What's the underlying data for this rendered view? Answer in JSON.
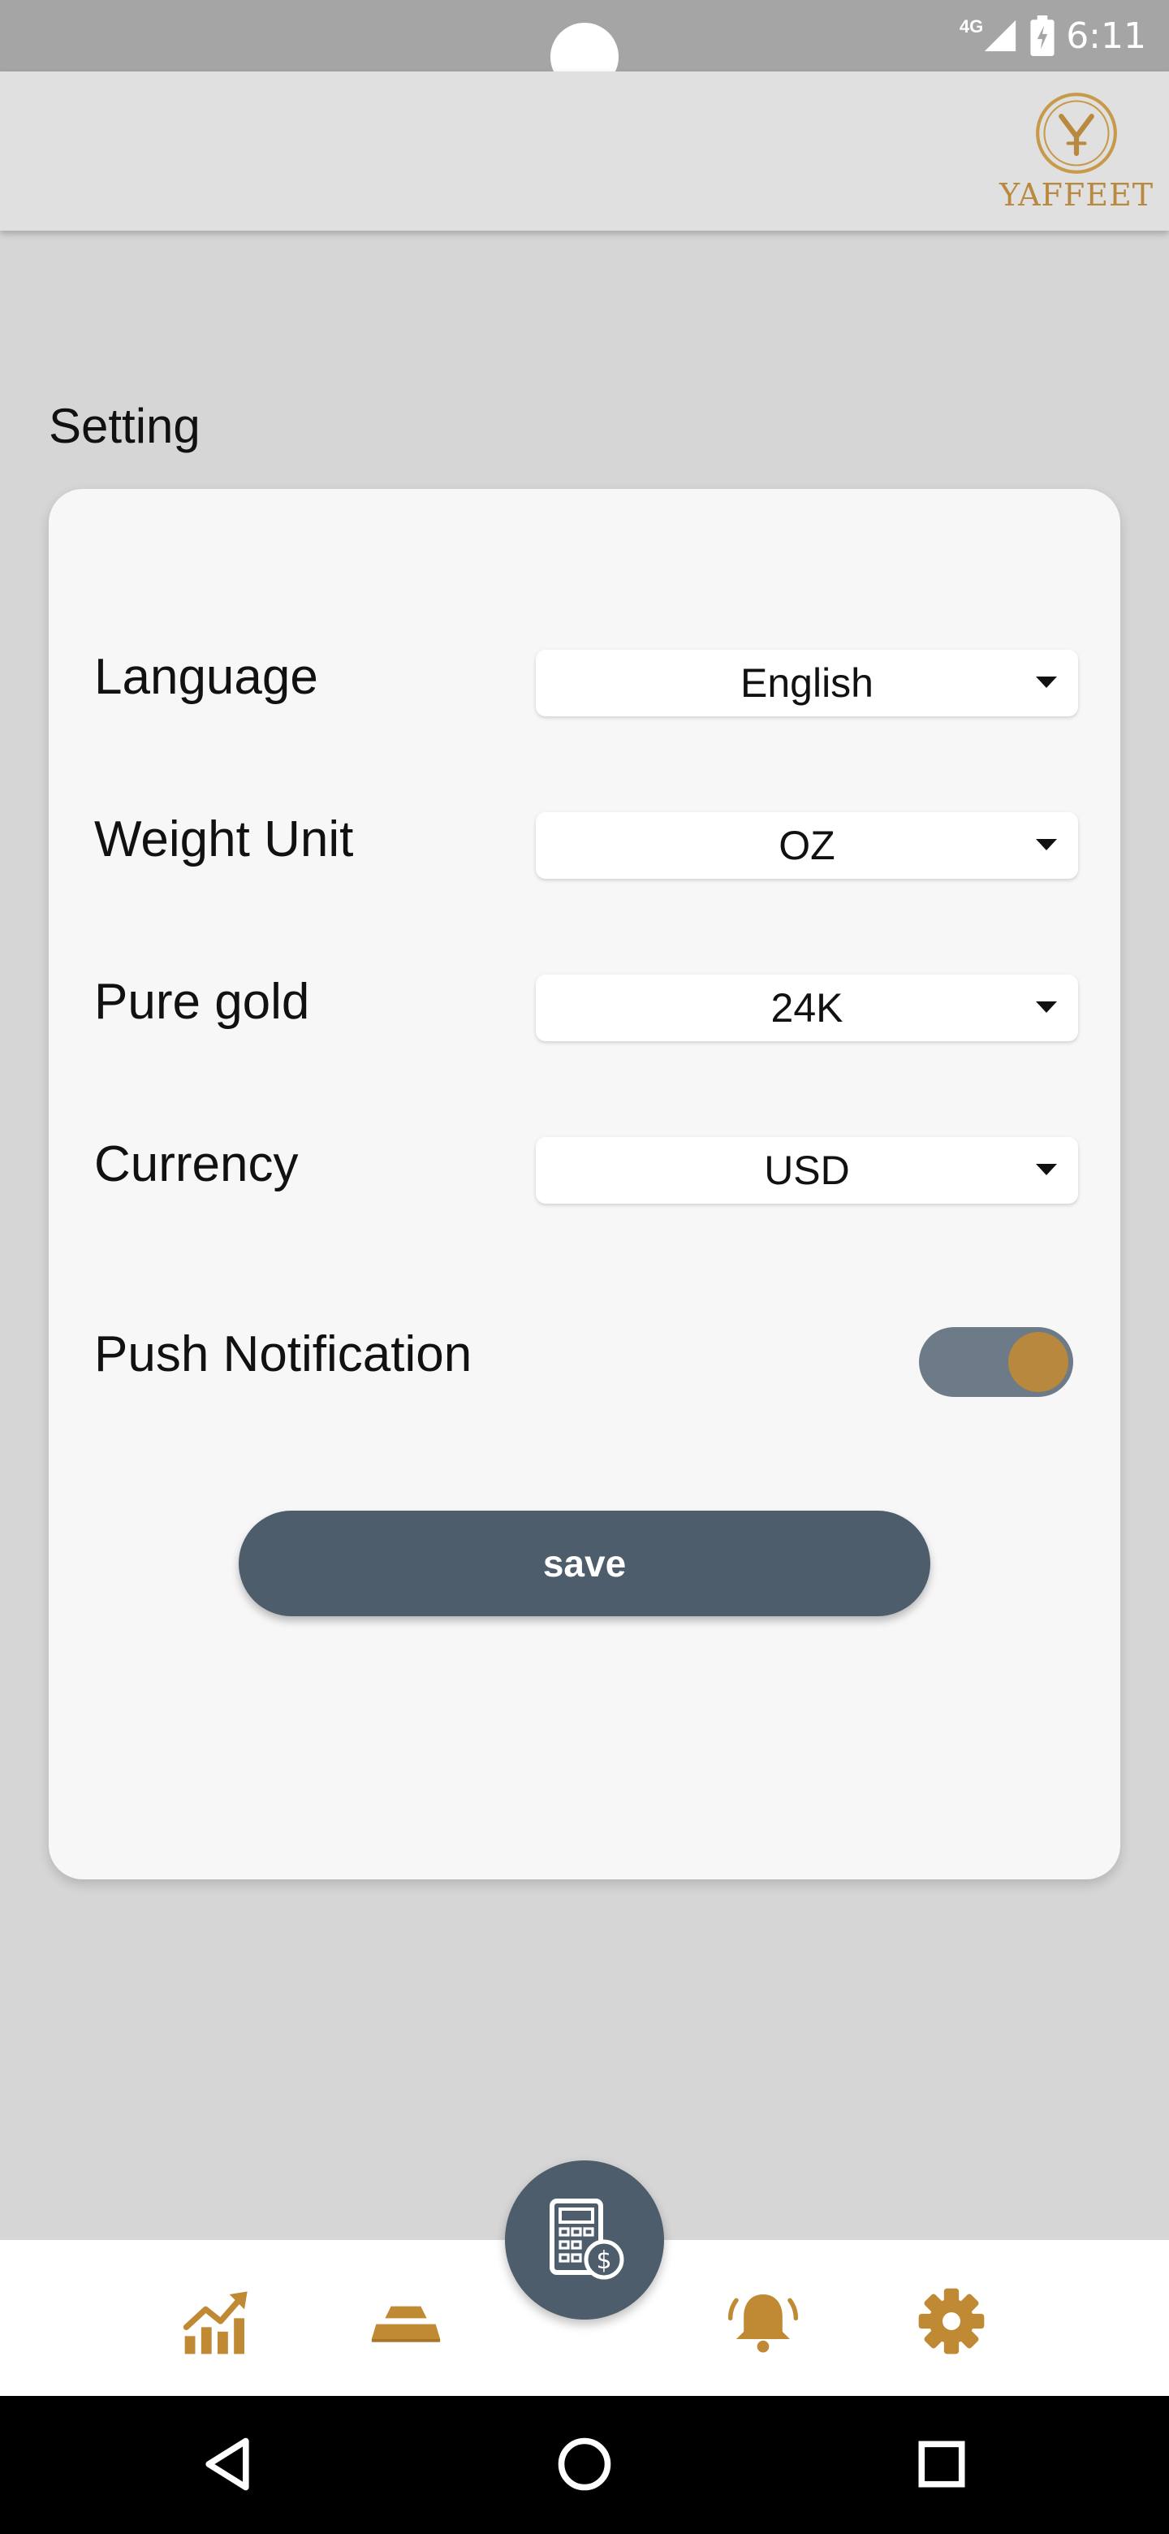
{
  "status_bar": {
    "network": "4G",
    "time": "6:11"
  },
  "header": {
    "brand_name": "YAFFEET",
    "brand_color": "#b8893e"
  },
  "page": {
    "title": "Setting"
  },
  "settings": {
    "language": {
      "label": "Language",
      "value": "English"
    },
    "weight_unit": {
      "label": "Weight Unit",
      "value": "OZ"
    },
    "pure_gold": {
      "label": "Pure gold",
      "value": "24K"
    },
    "currency": {
      "label": "Currency",
      "value": "USD"
    },
    "push_notification": {
      "label": "Push Notification",
      "enabled": true
    },
    "save_label": "save"
  },
  "bottom_nav": {
    "items": [
      {
        "icon": "chart-growth-icon"
      },
      {
        "icon": "gold-bars-icon"
      },
      {
        "icon": "calculator-dollar-icon"
      },
      {
        "icon": "bell-icon"
      },
      {
        "icon": "gear-icon"
      }
    ],
    "icon_color": "#c08a35",
    "fab_color": "#4d5d6c"
  },
  "system_nav": {
    "items": [
      {
        "icon": "back-triangle-icon"
      },
      {
        "icon": "home-circle-icon"
      },
      {
        "icon": "recents-square-icon"
      }
    ]
  }
}
